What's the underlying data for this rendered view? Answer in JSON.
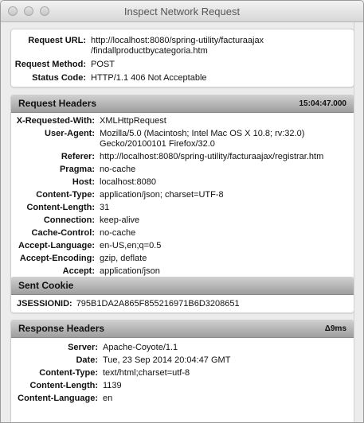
{
  "window": {
    "title": "Inspect Network Request"
  },
  "summary": [
    {
      "key": "Request URL:",
      "value": "http://localhost:8080/spring-utility/facturaajax\n/findallproductbycategoria.htm"
    },
    {
      "key": "Request Method:",
      "value": "POST"
    },
    {
      "key": "Status Code:",
      "value": "HTTP/1.1 406 Not Acceptable"
    }
  ],
  "request_headers": {
    "title": "Request Headers",
    "time": "15:04:47.000",
    "rows": [
      {
        "key": "X-Requested-With:",
        "value": "XMLHttpRequest"
      },
      {
        "key": "User-Agent:",
        "value": "Mozilla/5.0 (Macintosh; Intel Mac OS X 10.8; rv:32.0)\nGecko/20100101 Firefox/32.0"
      },
      {
        "key": "Referer:",
        "value": "http://localhost:8080/spring-utility/facturaajax/registrar.htm"
      },
      {
        "key": "Pragma:",
        "value": "no-cache"
      },
      {
        "key": "Host:",
        "value": "localhost:8080"
      },
      {
        "key": "Content-Type:",
        "value": "application/json; charset=UTF-8"
      },
      {
        "key": "Content-Length:",
        "value": "31"
      },
      {
        "key": "Connection:",
        "value": "keep-alive"
      },
      {
        "key": "Cache-Control:",
        "value": "no-cache"
      },
      {
        "key": "Accept-Language:",
        "value": "en-US,en;q=0.5"
      },
      {
        "key": "Accept-Encoding:",
        "value": "gzip, deflate"
      },
      {
        "key": "Accept:",
        "value": "application/json"
      }
    ]
  },
  "sent_cookie": {
    "title": "Sent Cookie",
    "rows": [
      {
        "key": "JSESSIONID:",
        "value": "795B1DA2A865F855216971B6D3208651"
      }
    ]
  },
  "response_headers": {
    "title": "Response Headers",
    "time": "Δ9ms",
    "rows": [
      {
        "key": "Server:",
        "value": "Apache-Coyote/1.1"
      },
      {
        "key": "Date:",
        "value": "Tue, 23 Sep 2014 20:04:47 GMT"
      },
      {
        "key": "Content-Type:",
        "value": "text/html;charset=utf-8"
      },
      {
        "key": "Content-Length:",
        "value": "1139"
      },
      {
        "key": "Content-Language:",
        "value": "en"
      }
    ]
  }
}
